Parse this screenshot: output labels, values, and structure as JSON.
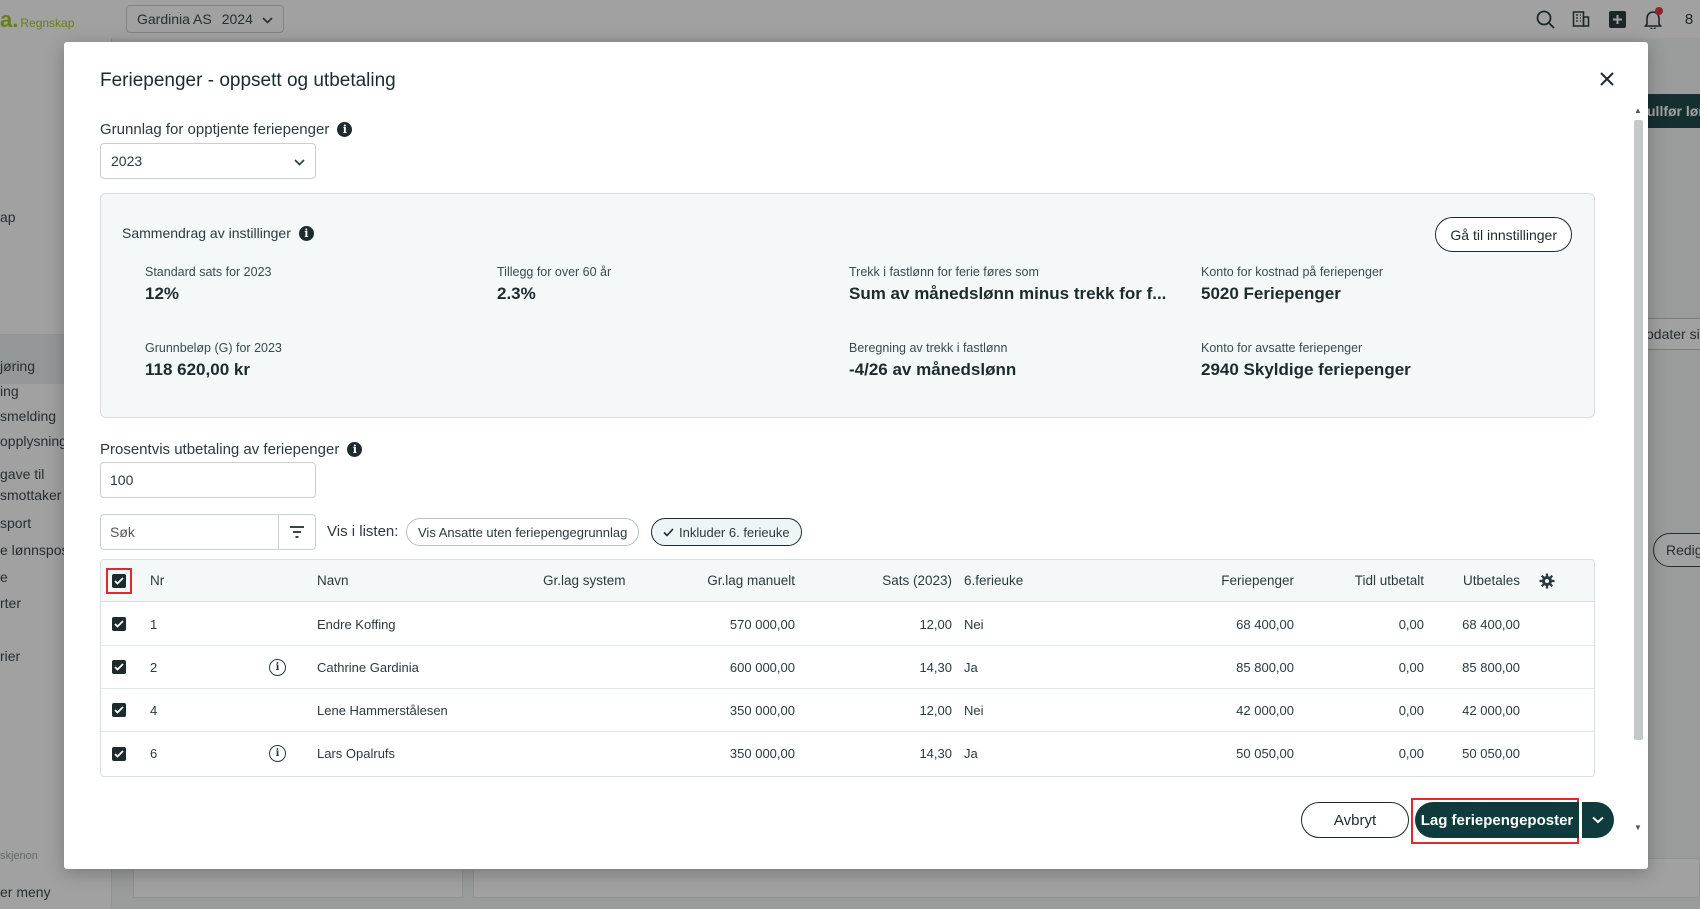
{
  "app": {
    "logo_mark": "a.",
    "logo_text": "Regnskap",
    "company": "Gardinia AS",
    "company_year": "2024",
    "sidebar": [
      "ap",
      "jøring",
      "ing",
      "smelding",
      "opplysning",
      "gave til",
      "smottaker",
      "e lønnspos",
      "sport",
      "e",
      "rter",
      "rier",
      "skjenon",
      "er meny"
    ],
    "bg_complete_btn": "ullfør lønn",
    "bg_update_btn": "odater si",
    "bg_edit_btn": "Redig",
    "edge_glyph": "8"
  },
  "modal": {
    "title": "Feriepenger - oppsett og utbetaling",
    "basis_label": "Grunnlag for opptjente feriepenger",
    "basis_year": "2023",
    "summary": {
      "title": "Sammendrag av instillinger",
      "goto_label": "Gå til innstillinger",
      "items": [
        {
          "label": "Standard sats for 2023",
          "value": "12%"
        },
        {
          "label": "Tillegg for over 60 år",
          "value": "2.3%"
        },
        {
          "label": "Trekk i fastlønn for ferie føres som",
          "value": "Sum av månedslønn minus trekk for f..."
        },
        {
          "label": "Konto for kostnad på feriepenger",
          "value": "5020 Feriepenger"
        },
        {
          "label": "Grunnbeløp (G) for 2023",
          "value": "118 620,00 kr"
        },
        {
          "label": "Beregning av trekk i fastlønn",
          "value": "-4/26 av månedslønn"
        },
        {
          "label": "Konto for avsatte feriepenger",
          "value": "2940 Skyldige feriepenger"
        }
      ]
    },
    "percent_label": "Prosentvis utbetaling av feriepenger",
    "percent_value": "100",
    "search_placeholder": "Søk",
    "show_label": "Vis i listen:",
    "chip_no_basis": "Vis Ansatte uten feriepengegrunnlag",
    "chip_sixth_week": "Inkluder 6. ferieuke",
    "table": {
      "headers": {
        "nr": "Nr",
        "name": "Navn",
        "gr_system": "Gr.lag system",
        "gr_manual": "Gr.lag manuelt",
        "rate": "Sats (2023)",
        "sixth": "6.ferieuke",
        "holiday_pay": "Feriepenger",
        "prev_paid": "Tidl utbetalt",
        "payout": "Utbetales"
      },
      "rows": [
        {
          "nr": "1",
          "info": false,
          "name": "Endre Koffing",
          "gr_manual": "570 000,00",
          "rate": "12,00",
          "sixth": "Nei",
          "holiday_pay": "68 400,00",
          "prev_paid": "0,00",
          "payout": "68 400,00"
        },
        {
          "nr": "2",
          "info": true,
          "name": "Cathrine Gardinia",
          "gr_manual": "600 000,00",
          "rate": "14,30",
          "sixth": "Ja",
          "holiday_pay": "85 800,00",
          "prev_paid": "0,00",
          "payout": "85 800,00"
        },
        {
          "nr": "4",
          "info": false,
          "name": "Lene Hammerstålesen",
          "gr_manual": "350 000,00",
          "rate": "12,00",
          "sixth": "Nei",
          "holiday_pay": "42 000,00",
          "prev_paid": "0,00",
          "payout": "42 000,00"
        },
        {
          "nr": "6",
          "info": true,
          "name": "Lars Opalrufs",
          "gr_manual": "350 000,00",
          "rate": "14,30",
          "sixth": "Ja",
          "holiday_pay": "50 050,00",
          "prev_paid": "0,00",
          "payout": "50 050,00"
        }
      ]
    },
    "cancel_label": "Avbryt",
    "primary_label": "Lag feriepengeposter"
  }
}
